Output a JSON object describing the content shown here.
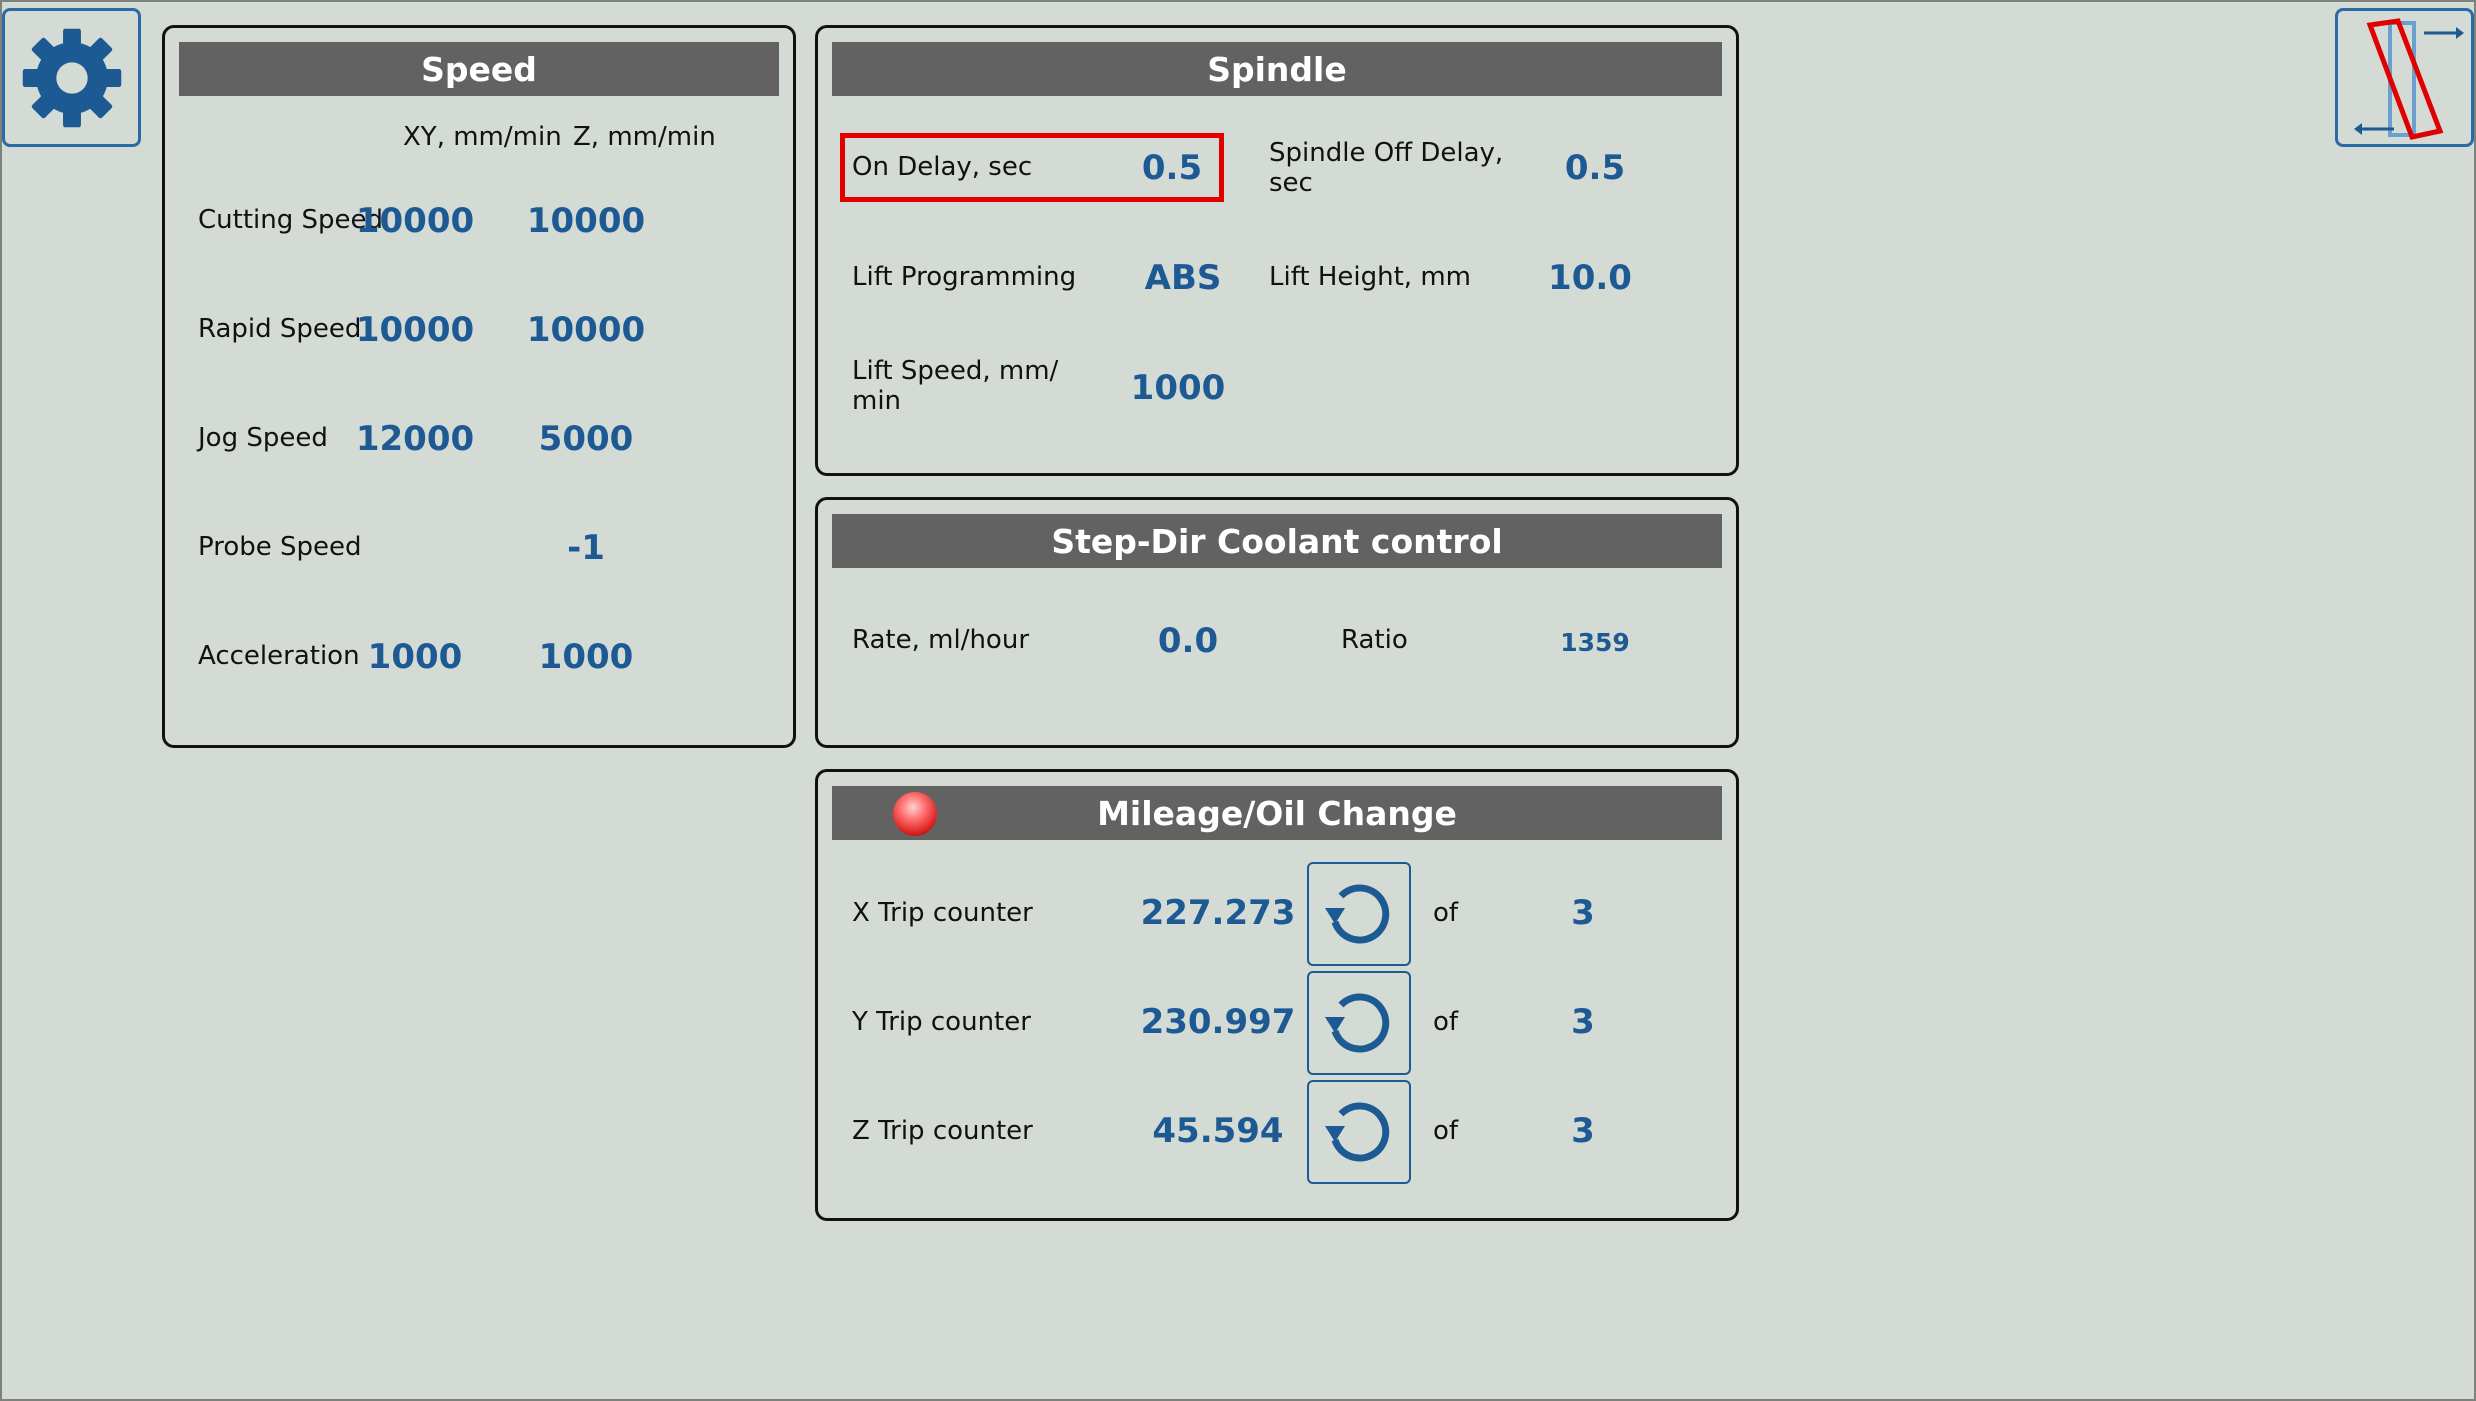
{
  "colors": {
    "background": "#d4dad4",
    "header": "#626262",
    "value": "#1d5a94",
    "highlight": "#e10000"
  },
  "toolbar": {
    "settings_icon": "gear-icon",
    "mode_icon": "slanted-frame-icon"
  },
  "speed": {
    "title": "Speed",
    "col_xy": "XY, mm/min",
    "col_z": "Z, mm/min",
    "rows": [
      {
        "label": "Cutting Speed",
        "xy": "10000",
        "z": "10000"
      },
      {
        "label": "Rapid Speed",
        "xy": "10000",
        "z": "10000"
      },
      {
        "label": "Jog Speed",
        "xy": "12000",
        "z": "5000"
      },
      {
        "label": "Probe Speed",
        "xy": "",
        "z": "-1"
      },
      {
        "label": "Acceleration",
        "xy": "1000",
        "z": "1000"
      }
    ]
  },
  "spindle": {
    "title": "Spindle",
    "on_delay_label": "On Delay, sec",
    "on_delay_value": "0.5",
    "off_delay_label": "Spindle Off Delay, sec",
    "off_delay_value": "0.5",
    "lift_programming_label": "Lift Programming",
    "lift_programming_value": "ABS",
    "lift_height_label": "Lift Height, mm",
    "lift_height_value": "10.0",
    "lift_speed_label": "Lift Speed, mm/ min",
    "lift_speed_value": "1000"
  },
  "coolant": {
    "title": "Step-Dir Coolant control",
    "rate_label": "Rate, ml/hour",
    "rate_value": "0.0",
    "ratio_label": "Ratio",
    "ratio_value": "1359"
  },
  "mileage": {
    "title": "Mileage/Oil Change",
    "indicator": "red-led-icon",
    "of_label": "of",
    "rows": [
      {
        "label": "X Trip counter",
        "value": "227.273",
        "limit": "3"
      },
      {
        "label": "Y Trip counter",
        "value": "230.997",
        "limit": "3"
      },
      {
        "label": "Z Trip counter",
        "value": "45.594",
        "limit": "3"
      }
    ]
  }
}
